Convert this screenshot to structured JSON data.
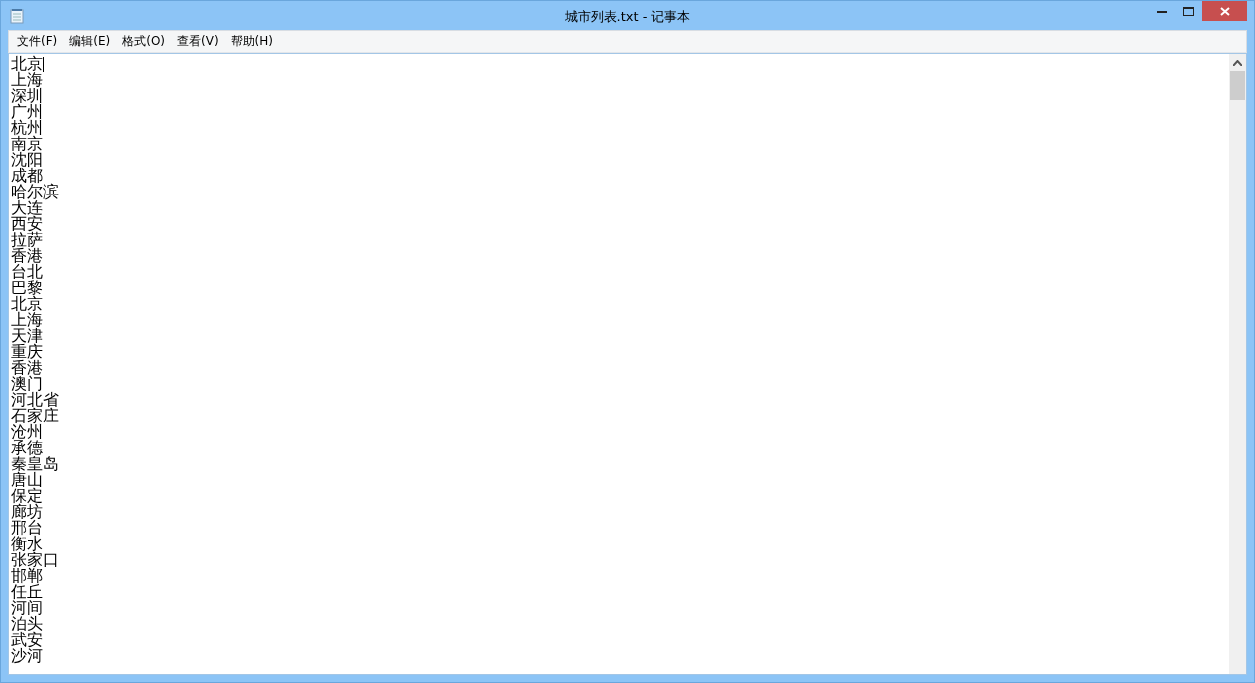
{
  "window": {
    "title": "城市列表.txt - 记事本"
  },
  "menu": [
    "文件(F)",
    "编辑(E)",
    "格式(O)",
    "查看(V)",
    "帮助(H)"
  ],
  "editor": {
    "lines": [
      "北京",
      "上海",
      "深圳",
      "广州",
      "杭州",
      "南京",
      "沈阳",
      "成都",
      "哈尔滨",
      "大连",
      "西安",
      "拉萨",
      "香港",
      "台北",
      "巴黎",
      "北京",
      "上海",
      "天津",
      "重庆",
      "香港",
      "澳门",
      "河北省",
      "石家庄",
      "沧州",
      "承德",
      "秦皇岛",
      "唐山",
      "保定",
      "廊坊",
      "邢台",
      "衡水",
      "张家口",
      "邯郸",
      "任丘",
      "河间",
      "泊头",
      "武安",
      "沙河"
    ]
  }
}
